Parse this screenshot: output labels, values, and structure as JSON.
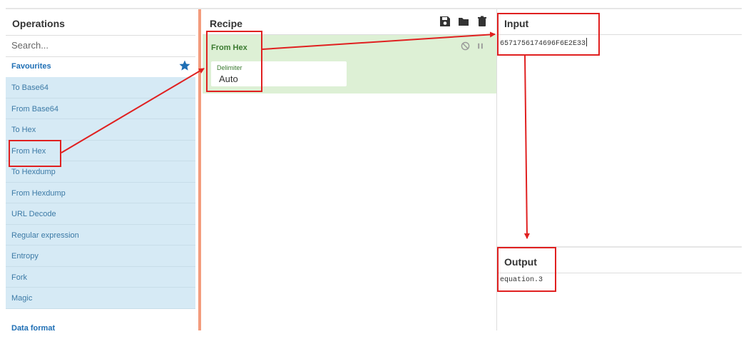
{
  "operations": {
    "title": "Operations",
    "search_placeholder": "Search...",
    "favourites_label": "Favourites",
    "items": [
      {
        "label": "To Base64"
      },
      {
        "label": "From Base64"
      },
      {
        "label": "To Hex"
      },
      {
        "label": "From Hex"
      },
      {
        "label": "To Hexdump"
      },
      {
        "label": "From Hexdump"
      },
      {
        "label": "URL Decode"
      },
      {
        "label": "Regular expression"
      },
      {
        "label": "Entropy"
      },
      {
        "label": "Fork"
      },
      {
        "label": "Magic"
      }
    ],
    "next_category": "Data format"
  },
  "recipe": {
    "title": "Recipe",
    "operation": {
      "name": "From Hex",
      "arg_label": "Delimiter",
      "arg_value": "Auto"
    }
  },
  "input": {
    "title": "Input",
    "value": "6571756174696F6E2E33"
  },
  "output": {
    "title": "Output",
    "value": "equation.3"
  },
  "colors": {
    "favourites_accent": "#1f6fb5",
    "operation_item_bg": "#d6eaf5",
    "recipe_op_bg": "#ddf0d5",
    "recipe_op_text": "#3a7a2f",
    "divider": "#f39c7d",
    "annotation_red": "#e02020"
  },
  "icons": [
    "star-icon",
    "save-icon",
    "folder-icon",
    "trash-icon",
    "disable-icon",
    "pause-icon"
  ]
}
